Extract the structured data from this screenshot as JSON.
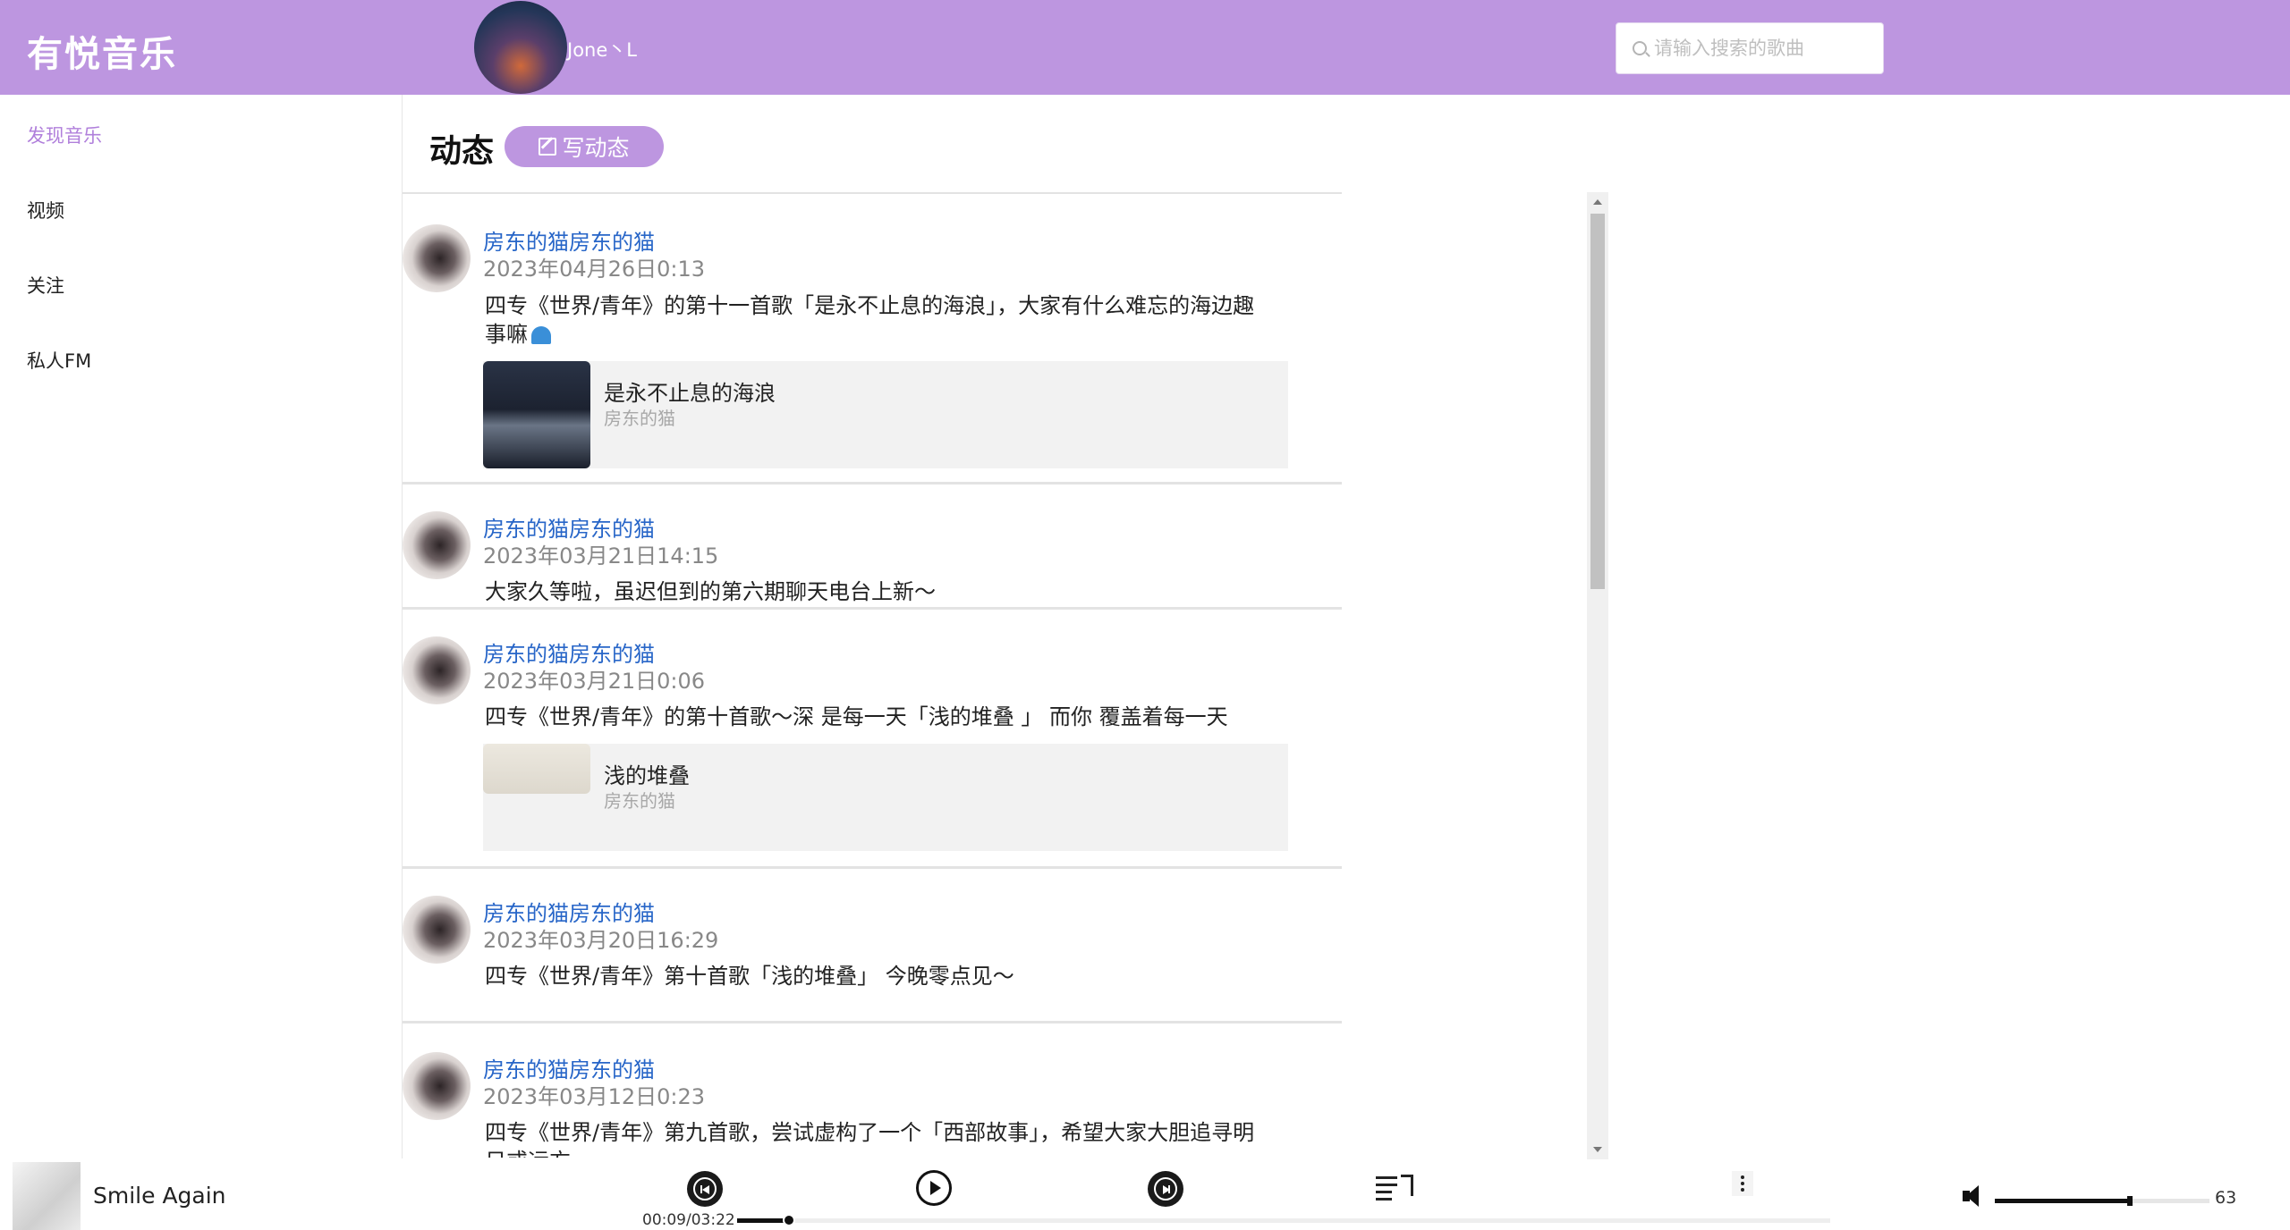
{
  "app": {
    "logo": "有悦音乐"
  },
  "user": {
    "name": "Jone丶L"
  },
  "search": {
    "placeholder": "请输入搜索的歌曲"
  },
  "sidebar": {
    "items": [
      {
        "label": "发现音乐",
        "active": true
      },
      {
        "label": "视频",
        "active": false
      },
      {
        "label": "关注",
        "active": false
      },
      {
        "label": "私人FM",
        "active": false
      }
    ]
  },
  "main": {
    "title": "动态",
    "write_button_label": "写动态"
  },
  "posts": [
    {
      "author": "房东的猫房东的猫",
      "time": "2023年04月26日0:13",
      "text": "四专《世界/青年》的第十一首歌「是永不止息的海浪」，大家有什么难忘的海边趣事嘛",
      "emoji_icon": "wave-icon",
      "song": {
        "name": "是永不止息的海浪",
        "artist": "房东的猫"
      }
    },
    {
      "author": "房东的猫房东的猫",
      "time": "2023年03月21日14:15",
      "text": "大家久等啦，虽迟但到的第六期聊天电台上新～"
    },
    {
      "author": "房东的猫房东的猫",
      "time": "2023年03月21日0:06",
      "text": "四专《世界/青年》的第十首歌～深 是每一天「浅的堆叠 」  而你 覆盖着每一天",
      "song": {
        "name": "浅的堆叠",
        "artist": "房东的猫"
      }
    },
    {
      "author": "房东的猫房东的猫",
      "time": "2023年03月20日16:29",
      "text": "四专《世界/青年》第十首歌「浅的堆叠」 今晚零点见～"
    },
    {
      "author": "房东的猫房东的猫",
      "time": "2023年03月12日0:23",
      "text": "四专《世界/青年》第九首歌，尝试虚构了一个「西部故事」，希望大家大胆追寻明日或远方"
    }
  ],
  "player": {
    "song_title": "Smile Again",
    "time": "00:09/03:22",
    "progress": 0.045,
    "volume": 63,
    "volume_display": "63"
  },
  "colors": {
    "accent": "#bd96e0",
    "active_text": "#b07fdb",
    "link": "#2866c8"
  }
}
